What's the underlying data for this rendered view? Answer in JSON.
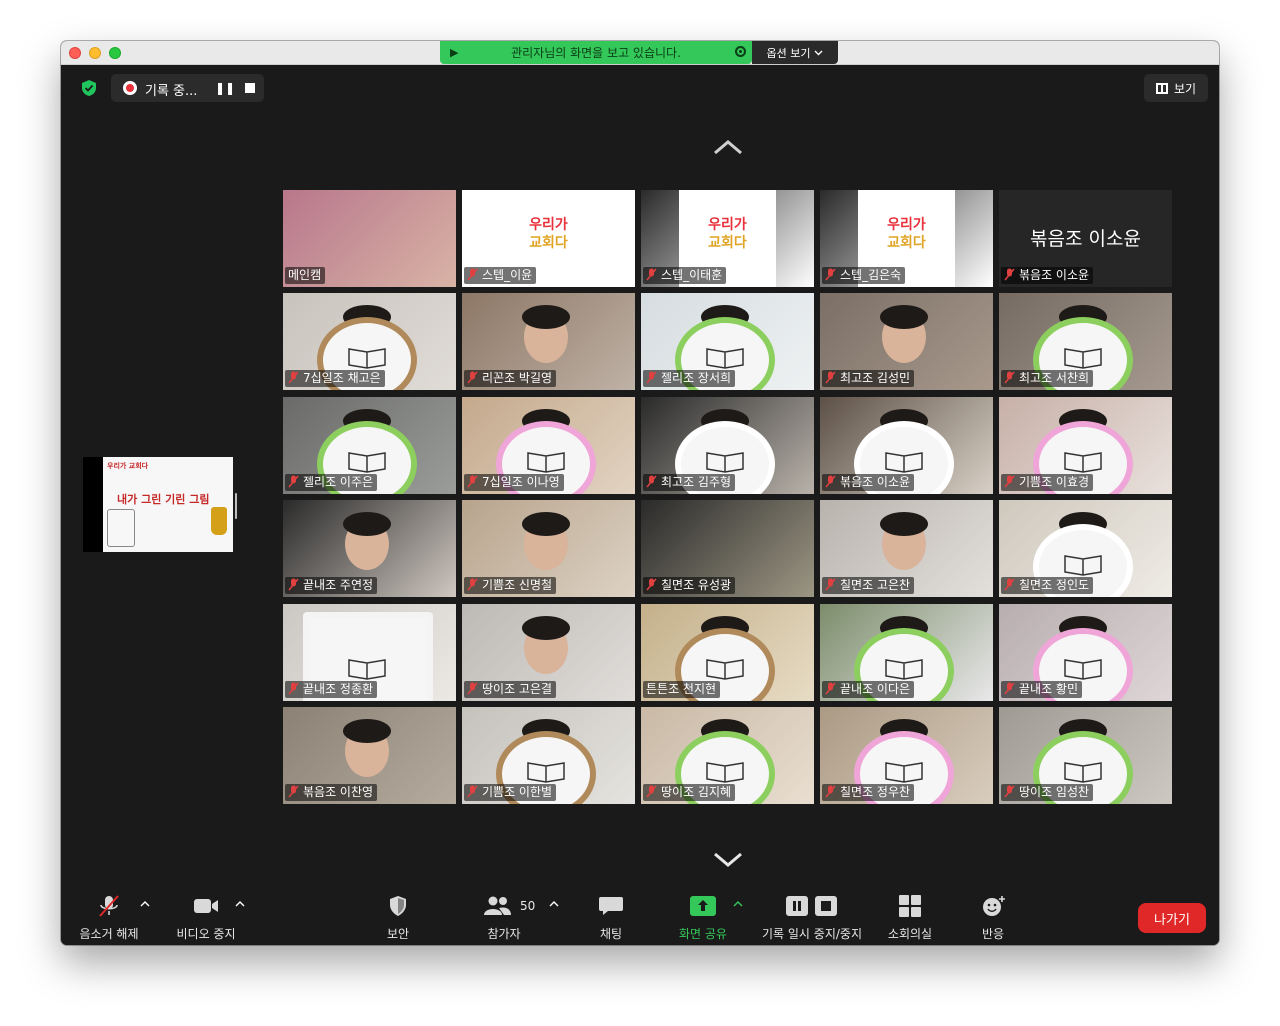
{
  "window": {
    "share_banner": "관리자님의 화면을 보고 있습니다.",
    "options_label": "옵션 보기",
    "recording_label": "기록 중...",
    "view_label": "보기",
    "accent_green": "#34c759",
    "active_speaker_color": "#d8e94a",
    "leave_color": "#e02828"
  },
  "share_thumbnail": {
    "title": "내가 그린 기린 그림",
    "brand": "우리가 교회다"
  },
  "participants": [
    {
      "name": "메인캠",
      "muted": false
    },
    {
      "name": "스텝_이윤",
      "muted": true
    },
    {
      "name": "스텝_이태훈",
      "muted": true
    },
    {
      "name": "스텝_김은숙",
      "muted": true
    },
    {
      "name": "볶음조 이소윤",
      "muted": true
    },
    {
      "name": "7십일조 채고은",
      "muted": true
    },
    {
      "name": "리꼰조 박길영",
      "muted": true
    },
    {
      "name": "젤리조 장서희",
      "muted": true
    },
    {
      "name": "최고조 김성민",
      "muted": true
    },
    {
      "name": "최고조 서찬희",
      "muted": true
    },
    {
      "name": "젤리조 이주은",
      "muted": true
    },
    {
      "name": "7십일조 이나영",
      "muted": true
    },
    {
      "name": "최고조 김주형",
      "muted": true
    },
    {
      "name": "볶음조 이소윤",
      "muted": true
    },
    {
      "name": "기쁨조 이효경",
      "muted": true
    },
    {
      "name": "끝내조 주연정",
      "muted": true
    },
    {
      "name": "기쁨조 신명철",
      "muted": true
    },
    {
      "name": "칠면조 유성광",
      "muted": true
    },
    {
      "name": "칠면조 고은찬",
      "muted": true
    },
    {
      "name": "칠면조 정인도",
      "muted": true
    },
    {
      "name": "끝내조 정종환",
      "muted": true
    },
    {
      "name": "땅이조 고은결",
      "muted": true
    },
    {
      "name": "튼튼조 천지현",
      "muted": false
    },
    {
      "name": "끝내조 이다은",
      "muted": true
    },
    {
      "name": "끝내조 황민",
      "muted": true
    },
    {
      "name": "볶음조 이찬영",
      "muted": true
    },
    {
      "name": "기쁨조 이한별",
      "muted": true
    },
    {
      "name": "땅이조 김지혜",
      "muted": true
    },
    {
      "name": "칠면조 정우찬",
      "muted": true
    },
    {
      "name": "땅이조 임성찬",
      "muted": true
    }
  ],
  "poster": {
    "line1": "우리가",
    "line2": "교회다"
  },
  "toolbar": {
    "unmute": "음소거 해제",
    "stop_video": "비디오 중지",
    "security": "보안",
    "participants": "참가자",
    "participants_count": "50",
    "chat": "채팅",
    "share_screen": "화면 공유",
    "record_pause_stop": "기록 일시 중지/중지",
    "breakout": "소회의실",
    "reactions": "반응",
    "leave": "나가기"
  }
}
